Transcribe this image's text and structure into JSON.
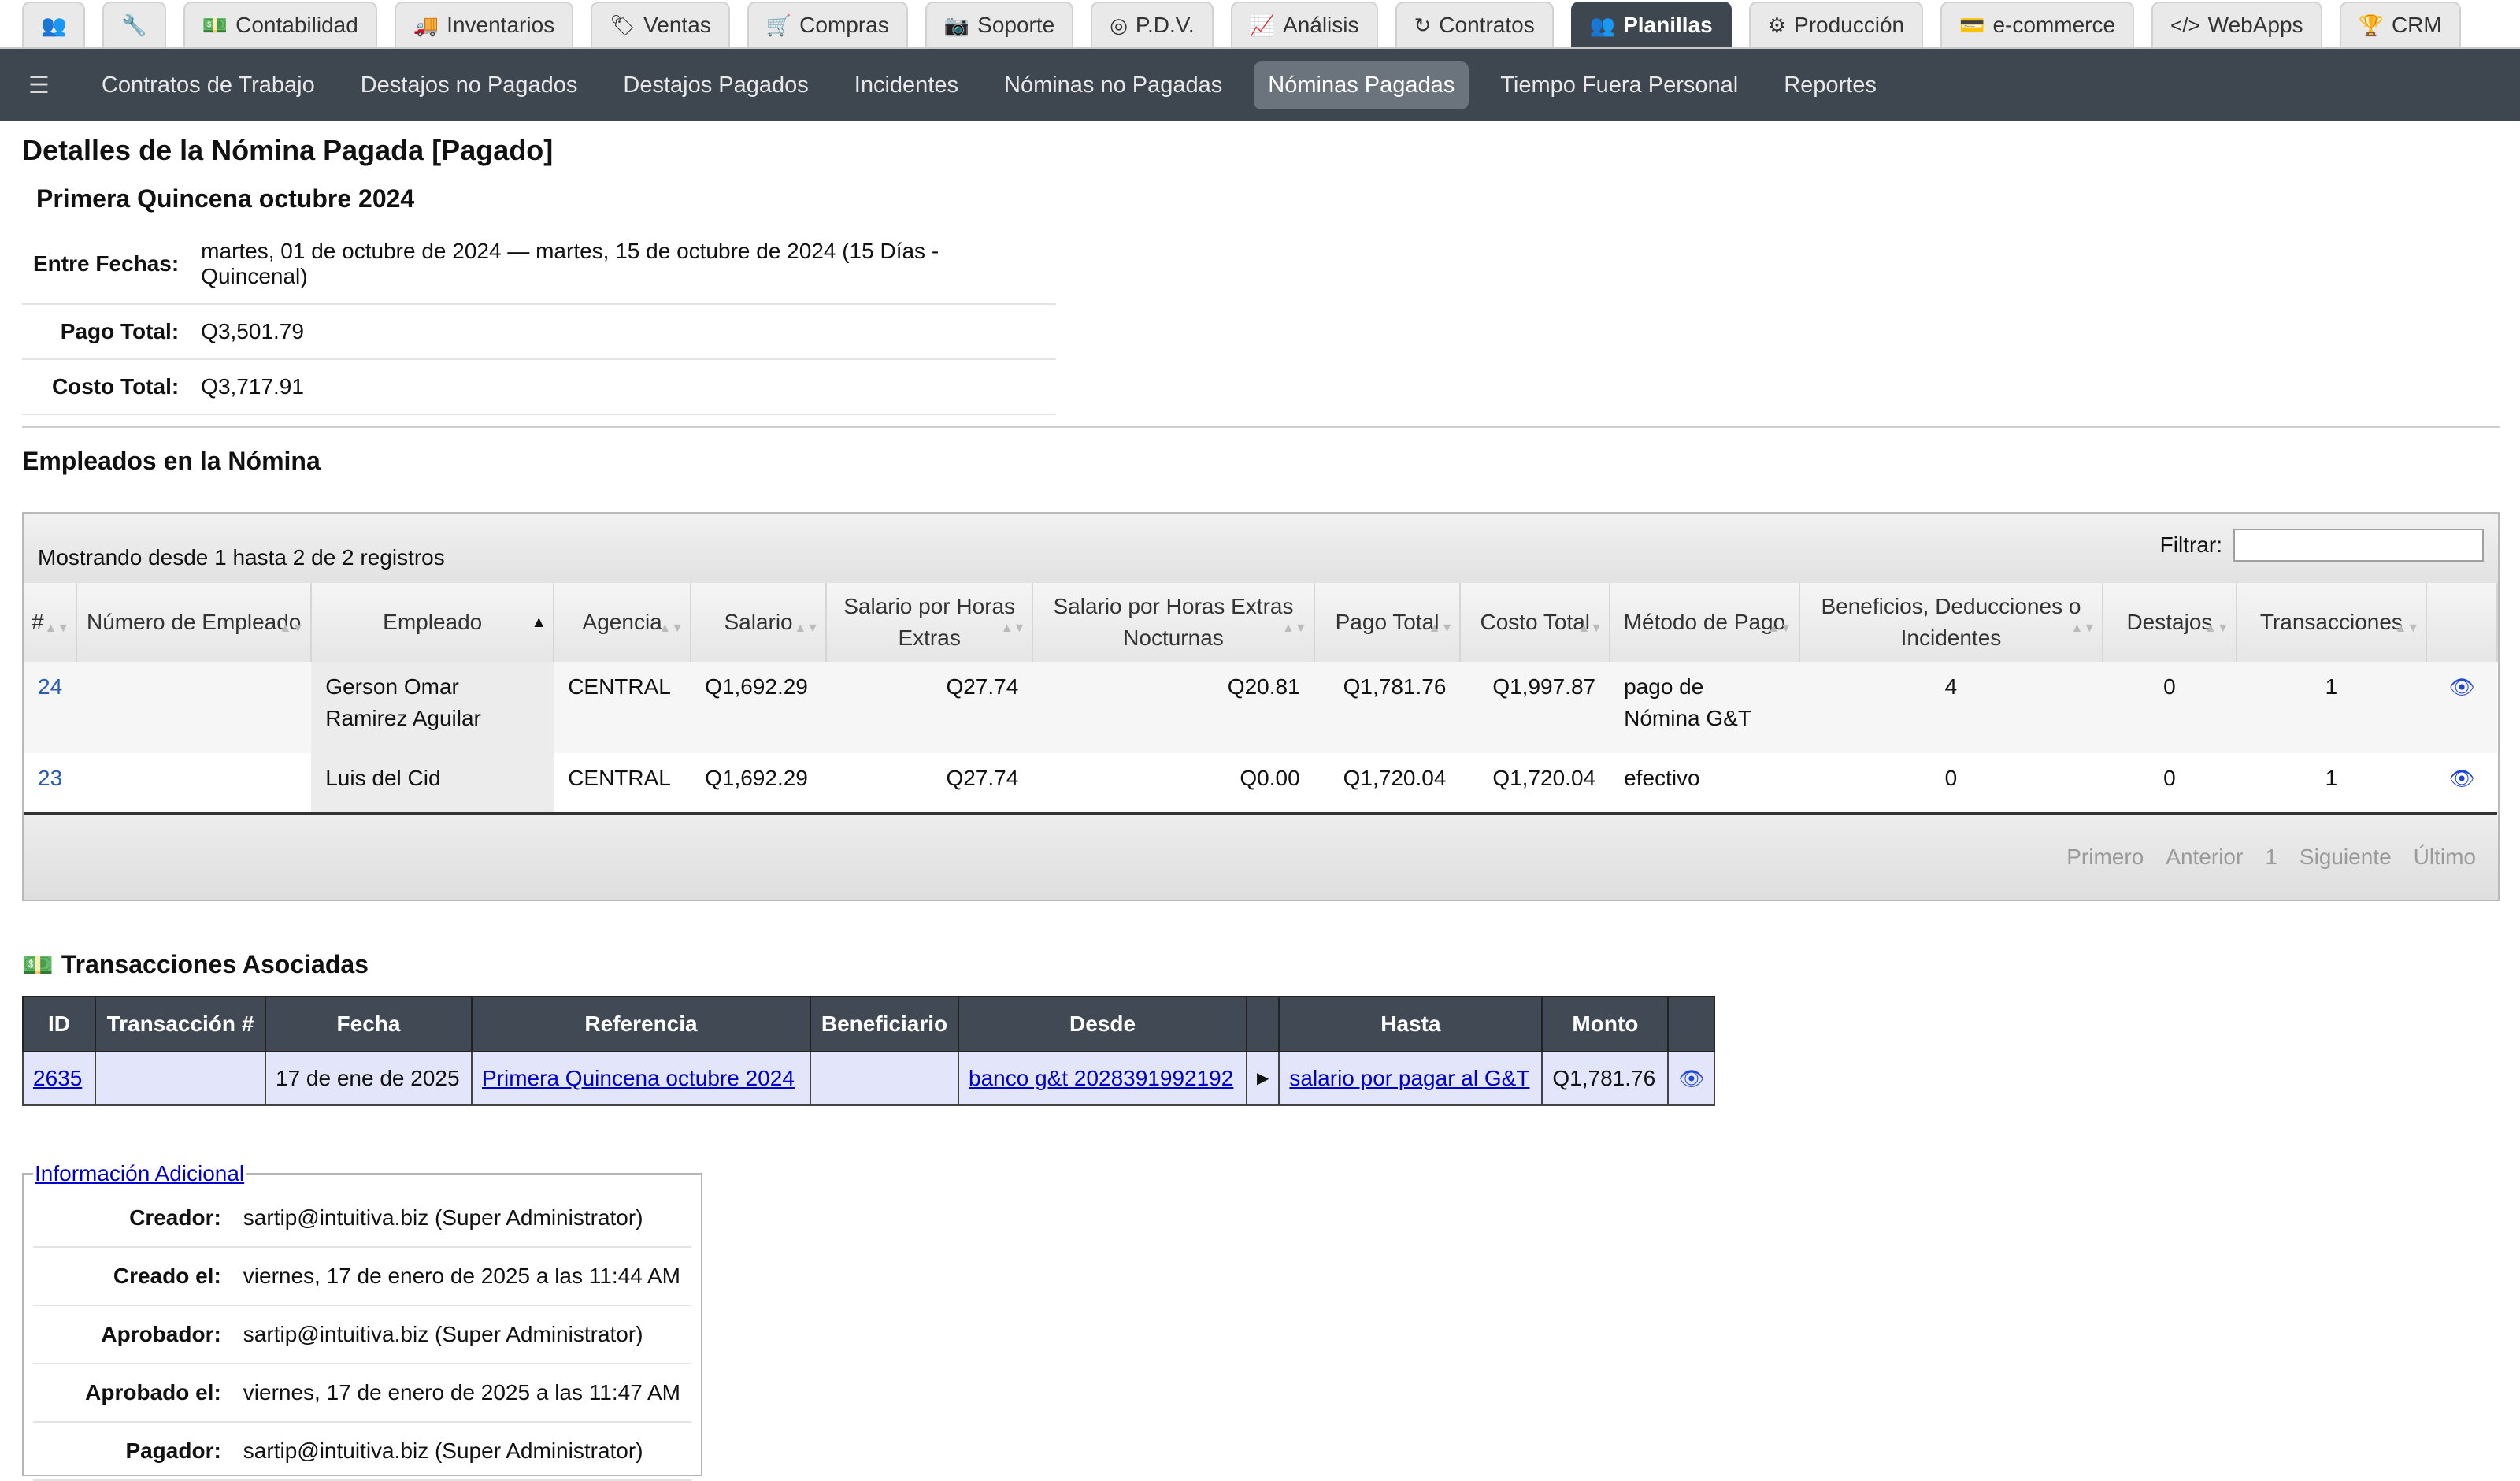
{
  "top_tabs": [
    {
      "icon": "users-icon",
      "glyph": "👥",
      "label": ""
    },
    {
      "icon": "wrench-icon",
      "glyph": "🔧",
      "label": ""
    },
    {
      "icon": "money-icon",
      "glyph": "💵",
      "label": "Contabilidad"
    },
    {
      "icon": "truck-icon",
      "glyph": "🚚",
      "label": "Inventarios"
    },
    {
      "icon": "tags-icon",
      "glyph": "🏷",
      "label": "Ventas"
    },
    {
      "icon": "cart-icon",
      "glyph": "🛒",
      "label": "Compras"
    },
    {
      "icon": "camera-icon",
      "glyph": "📷",
      "label": "Soporte"
    },
    {
      "icon": "bullseye-icon",
      "glyph": "◎",
      "label": "P.D.V."
    },
    {
      "icon": "chart-icon",
      "glyph": "📈",
      "label": "Análisis"
    },
    {
      "icon": "refresh-icon",
      "glyph": "↻",
      "label": "Contratos"
    },
    {
      "icon": "users-icon",
      "glyph": "👥",
      "label": "Planillas"
    },
    {
      "icon": "cogs-icon",
      "glyph": "⚙",
      "label": "Producción"
    },
    {
      "icon": "credit-card-icon",
      "glyph": "💳",
      "label": "e-commerce"
    },
    {
      "icon": "code-icon",
      "glyph": "</>",
      "label": "WebApps"
    },
    {
      "icon": "trophy-icon",
      "glyph": "🏆",
      "label": "CRM"
    }
  ],
  "sub_nav": [
    "Contratos de Trabajo",
    "Destajos no Pagados",
    "Destajos Pagados",
    "Incidentes",
    "Nóminas no Pagadas",
    "Nóminas Pagadas",
    "Tiempo Fuera Personal",
    "Reportes"
  ],
  "page": {
    "title": "Detalles de la Nómina Pagada [Pagado]",
    "subtitle": "Primera Quincena octubre 2024",
    "details": [
      {
        "label": "Entre Fechas:",
        "value": "martes, 01 de octubre de 2024 — martes, 15 de octubre de 2024 (15 Días - Quincenal)"
      },
      {
        "label": "Pago Total:",
        "value": "Q3,501.79"
      },
      {
        "label": "Costo Total:",
        "value": "Q3,717.91"
      }
    ]
  },
  "employees": {
    "title": "Empleados en la Nómina",
    "info": "Mostrando desde 1 hasta 2 de 2 registros",
    "filter_label": "Filtrar:",
    "filter_value": "",
    "headers": [
      "#",
      "Número de Empleado",
      "Empleado",
      "Agencia",
      "Salario",
      "Salario por Horas Extras",
      "Salario por Horas Extras Nocturnas",
      "Pago Total",
      "Costo Total",
      "Método de Pago",
      "Beneficios, Deducciones o Incidentes",
      "Destajos",
      "Transacciones"
    ],
    "rows": [
      {
        "id": "24",
        "num": "",
        "name": "Gerson Omar Ramirez Aguilar",
        "agency": "CENTRAL",
        "salary": "Q1,692.29",
        "extra": "Q27.74",
        "night": "Q20.81",
        "pay": "Q1,781.76",
        "cost": "Q1,997.87",
        "method": "pago de Nómina G&T",
        "benefits": "4",
        "piece": "0",
        "tx": "1"
      },
      {
        "id": "23",
        "num": "",
        "name": "Luis del Cid",
        "agency": "CENTRAL",
        "salary": "Q1,692.29",
        "extra": "Q27.74",
        "night": "Q0.00",
        "pay": "Q1,720.04",
        "cost": "Q1,720.04",
        "method": "efectivo",
        "benefits": "0",
        "piece": "0",
        "tx": "1"
      }
    ],
    "pagination": [
      "Primero",
      "Anterior",
      "1",
      "Siguiente",
      "Último"
    ]
  },
  "transactions": {
    "title": "Transacciones Asociadas",
    "headers": [
      "ID",
      "Transacción #",
      "Fecha",
      "Referencia",
      "Beneficiario",
      "Desde",
      "",
      "Hasta",
      "Monto",
      ""
    ],
    "row": {
      "id": "2635",
      "num": "",
      "date": "17 de ene de 2025",
      "ref": "Primera Quincena octubre 2024",
      "beneficiary": "",
      "from": "banco g&t 2028391992192",
      "to": "salario por pagar al G&T",
      "amount": "Q1,781.76"
    }
  },
  "additional": {
    "legend": "Información Adicional",
    "rows": [
      {
        "label": "Creador:",
        "value": "sartip@intuitiva.biz (Super Administrator)"
      },
      {
        "label": "Creado el:",
        "value": "viernes, 17 de enero de 2025 a las 11:44 AM"
      },
      {
        "label": "Aprobador:",
        "value": "sartip@intuitiva.biz (Super Administrator)"
      },
      {
        "label": "Aprobado el:",
        "value": "viernes, 17 de enero de 2025 a las 11:47 AM"
      },
      {
        "label": "Pagador:",
        "value": "sartip@intuitiva.biz (Super Administrator)"
      }
    ]
  }
}
